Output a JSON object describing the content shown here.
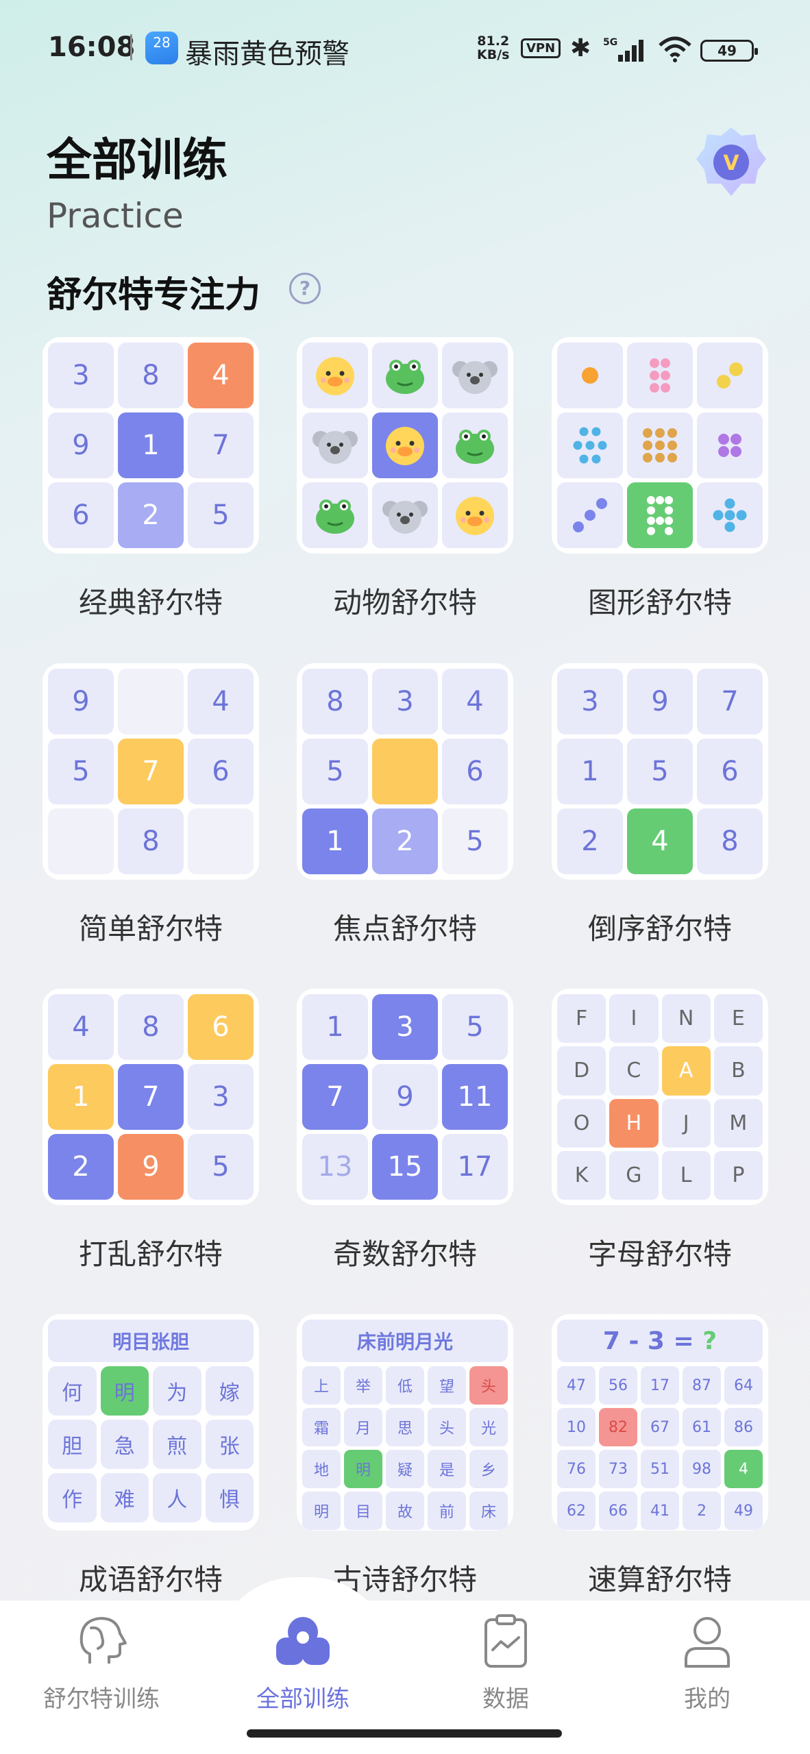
{
  "status_bar": {
    "time": "16:08",
    "weather_temp": "28",
    "weather_alert": "暴雨黄色预警",
    "net_speed_value": "81.2",
    "net_speed_unit": "KB/s",
    "vpn": "VPN",
    "network": "5G",
    "battery": "49"
  },
  "header": {
    "title": "全部训练",
    "subtitle": "Practice",
    "vip_badge": "V"
  },
  "section": {
    "title": "舒尔特专注力",
    "help": "?"
  },
  "cards": [
    {
      "label": "经典舒尔特",
      "cells": [
        "3",
        "8",
        "4",
        "9",
        "1",
        "7",
        "6",
        "2",
        "5"
      ]
    },
    {
      "label": "动物舒尔特"
    },
    {
      "label": "图形舒尔特"
    },
    {
      "label": "简单舒尔特",
      "cells": [
        "9",
        "",
        "4",
        "5",
        "7",
        "6",
        "",
        "8",
        ""
      ]
    },
    {
      "label": "焦点舒尔特",
      "cells": [
        "8",
        "3",
        "4",
        "5",
        "",
        "6",
        "1",
        "2",
        "5"
      ]
    },
    {
      "label": "倒序舒尔特",
      "cells": [
        "3",
        "9",
        "7",
        "1",
        "5",
        "6",
        "2",
        "4",
        "8"
      ]
    },
    {
      "label": "打乱舒尔特",
      "cells": [
        "4",
        "8",
        "6",
        "1",
        "7",
        "3",
        "2",
        "9",
        "5"
      ]
    },
    {
      "label": "奇数舒尔特",
      "cells": [
        "1",
        "3",
        "5",
        "7",
        "9",
        "11",
        "13",
        "15",
        "17"
      ]
    },
    {
      "label": "字母舒尔特",
      "cells": [
        "F",
        "I",
        "N",
        "E",
        "D",
        "C",
        "A",
        "B",
        "O",
        "H",
        "J",
        "M",
        "K",
        "G",
        "L",
        "P"
      ]
    },
    {
      "label": "成语舒尔特",
      "header": "明目张胆",
      "cells": [
        "何",
        "明",
        "为",
        "嫁",
        "胆",
        "急",
        "煎",
        "张",
        "作",
        "难",
        "人",
        "惧"
      ]
    },
    {
      "label": "古诗舒尔特",
      "header": "床前明月光",
      "cells": [
        "上",
        "举",
        "低",
        "望",
        "头",
        "霜",
        "月",
        "思",
        "头",
        "光",
        "地",
        "明",
        "疑",
        "是",
        "乡",
        "明",
        "目",
        "故",
        "前",
        "床"
      ]
    },
    {
      "label": "速算舒尔特",
      "header_expr": "7 - 3 =",
      "header_q": "?",
      "cells": [
        "47",
        "56",
        "17",
        "87",
        "64",
        "10",
        "82",
        "67",
        "61",
        "86",
        "76",
        "73",
        "51",
        "98",
        "4",
        "62",
        "66",
        "41",
        "2",
        "49"
      ]
    }
  ],
  "tabbar": [
    {
      "label": "舒尔特训练",
      "icon": "head-icon"
    },
    {
      "label": "全部训练",
      "icon": "all-training-icon",
      "active": true
    },
    {
      "label": "数据",
      "icon": "clipboard-chart-icon"
    },
    {
      "label": "我的",
      "icon": "user-icon"
    }
  ],
  "colors": {
    "accent": "#7b84ea",
    "orange": "#f69064",
    "yellow": "#fdca5e",
    "green": "#65cc74",
    "cell_bg": "#e8eafa"
  }
}
